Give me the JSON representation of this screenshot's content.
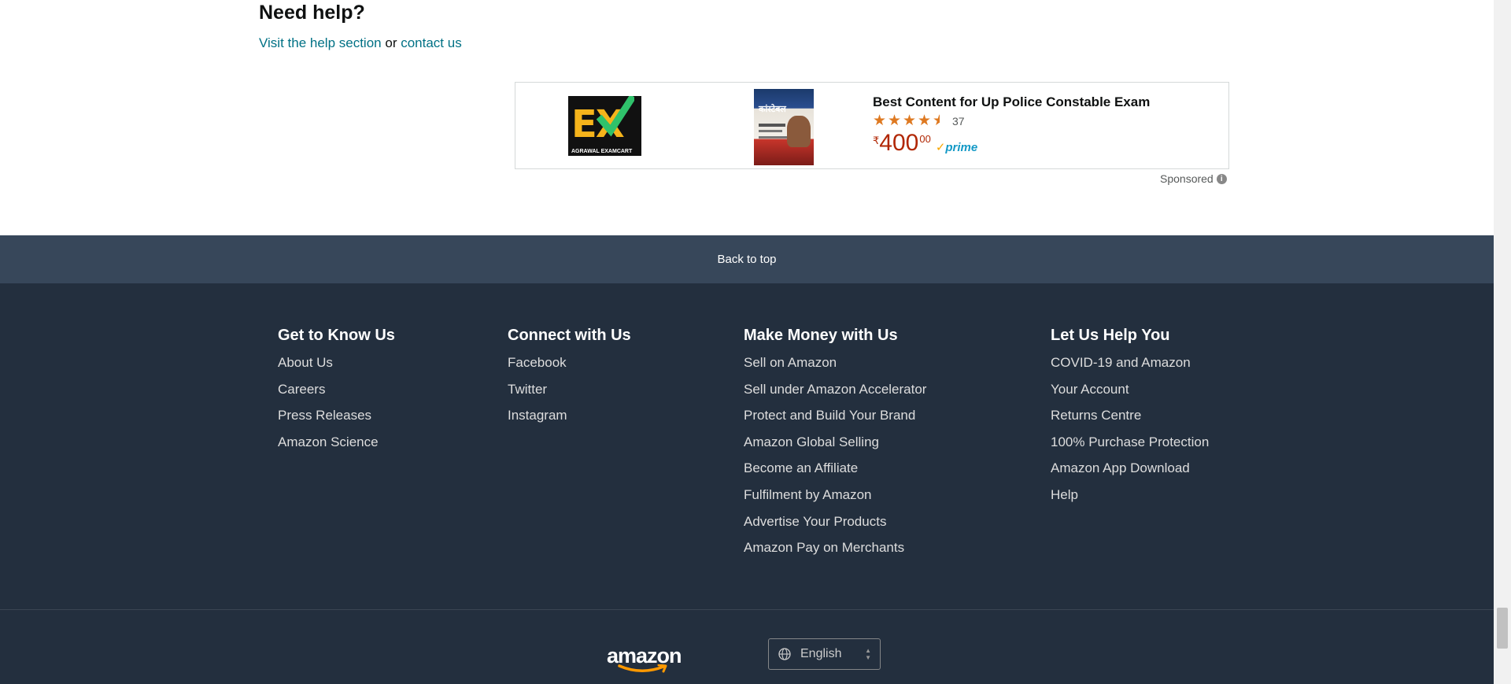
{
  "help": {
    "title": "Need help?",
    "visit_link": "Visit the help section",
    "or_text": "or",
    "contact_link": "contact us"
  },
  "ad": {
    "logo_text": "EX",
    "logo_brand": "AGRAWAL EXAMCART",
    "book_title": "कांस्टेबल",
    "title": "Best Content for Up Police Constable Exam",
    "rating": 4.5,
    "rating_count": "37",
    "currency": "₹",
    "price_whole": "400",
    "price_fraction": "00",
    "prime_label": "prime",
    "sponsored": "Sponsored",
    "star_color": "#de7921",
    "price_color": "#b12704"
  },
  "back_to_top": "Back to top",
  "footer": {
    "columns": [
      {
        "title": "Get to Know Us",
        "links": [
          "About Us",
          "Careers",
          "Press Releases",
          "Amazon Science"
        ]
      },
      {
        "title": "Connect with Us",
        "links": [
          "Facebook",
          "Twitter",
          "Instagram"
        ]
      },
      {
        "title": "Make Money with Us",
        "links": [
          "Sell on Amazon",
          "Sell under Amazon Accelerator",
          "Protect and Build Your Brand",
          "Amazon Global Selling",
          "Become an Affiliate",
          "Fulfilment by Amazon",
          "Advertise Your Products",
          "Amazon Pay on Merchants"
        ]
      },
      {
        "title": "Let Us Help You",
        "links": [
          "COVID-19 and Amazon",
          "Your Account",
          "Returns Centre",
          "100% Purchase Protection",
          "Amazon App Download",
          "Help"
        ]
      }
    ],
    "logo_text": "amazon",
    "language": "English",
    "colors": {
      "background": "#232f3e",
      "back_to_top_bg": "#37475a",
      "link_teal": "#007185"
    }
  }
}
